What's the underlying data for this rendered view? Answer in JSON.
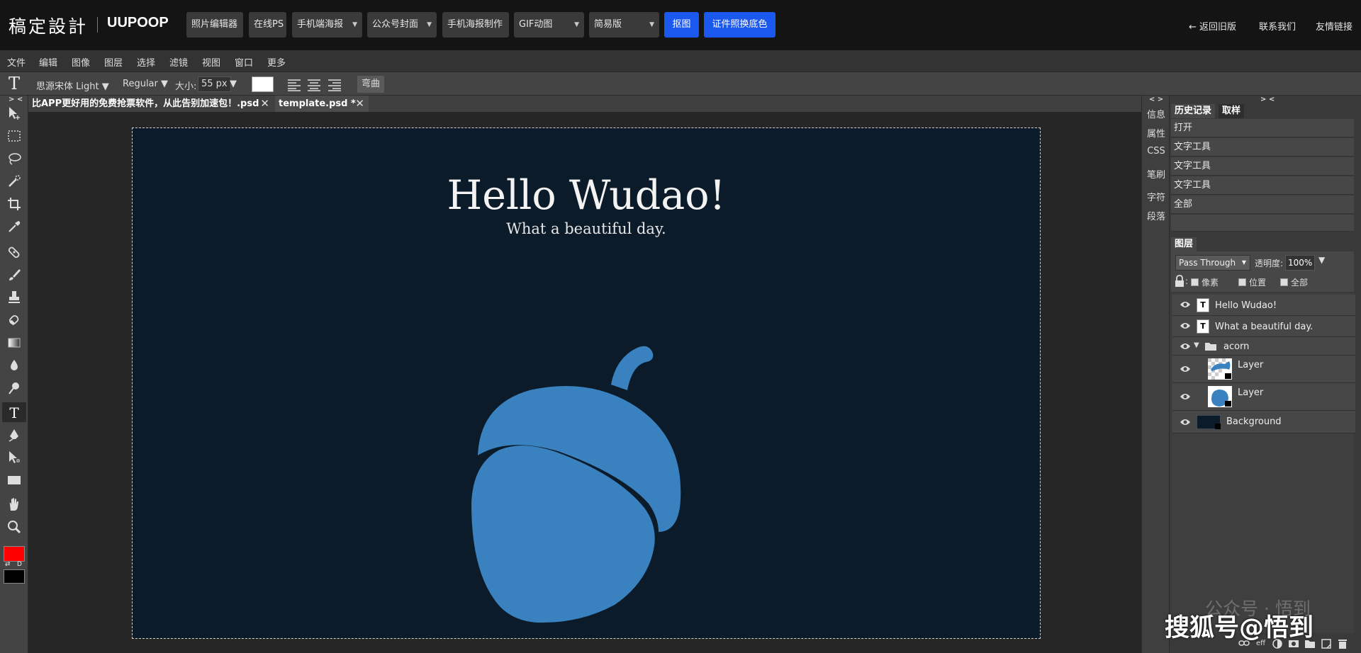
{
  "topbar": {
    "logo": "稿定設計",
    "brand": "UUPOOP",
    "buttons": [
      {
        "label": "照片编辑器"
      },
      {
        "label": "在线PS"
      },
      {
        "label": "手机端海报"
      },
      {
        "label": "公众号封面"
      },
      {
        "label": "手机海报制作"
      },
      {
        "label": "GIF动图"
      },
      {
        "label": "简易版"
      }
    ],
    "blue_buttons": [
      {
        "label": "抠图"
      },
      {
        "label": "证件照换底色"
      }
    ],
    "links": {
      "back_old": "← 返回旧版",
      "contact": "联系我们",
      "friend_links": "友情链接"
    }
  },
  "menubar": [
    "文件",
    "编辑",
    "图像",
    "图层",
    "选择",
    "滤镜",
    "视图",
    "窗口",
    "更多"
  ],
  "options": {
    "font_family": "思源宋体 Light ▼",
    "font_style": "Regular ▼",
    "size_label": "大小:",
    "size_value": "55 px",
    "size_arrow": "▼",
    "warp": "弯曲",
    "text_color": "#ffffff"
  },
  "colors": {
    "foreground": "#ff0000",
    "background": "#000000",
    "accent": "#1a58f0",
    "canvas": "#0b1b29",
    "acorn": "#3a81bf"
  },
  "toolbox": {
    "collapse": "> <",
    "swap": "⇄",
    "default": "D"
  },
  "tabs": [
    {
      "label": "比APP更好用的免费抢票软件，从此告别加速包！.psd",
      "close": "✕"
    },
    {
      "label": "template.psd *",
      "close": "✕"
    }
  ],
  "canvas": {
    "title": "Hello Wudao!",
    "subtitle": "What a beautiful day."
  },
  "mini_panel": {
    "toggle": "< >",
    "items": [
      "信息",
      "属性",
      "CSS",
      "笔刷",
      "字符",
      "段落"
    ]
  },
  "right_panel": {
    "toggle": "> <",
    "history_tabs": [
      "历史记录",
      "取样"
    ],
    "history": [
      "打开",
      "文字工具",
      "文字工具",
      "文字工具",
      "全部"
    ],
    "layers_tab": "图层",
    "blend_mode": "Pass Through",
    "opacity_label": "透明度:",
    "opacity_value": "100%",
    "lock_label": ":",
    "lock_options": [
      "像素",
      "位置",
      "全部"
    ],
    "layers": [
      {
        "name": "Hello Wudao!"
      },
      {
        "name": "What a beautiful day."
      },
      {
        "name": "acorn"
      },
      {
        "name": "Layer"
      },
      {
        "name": "Layer"
      },
      {
        "name": "Background"
      }
    ],
    "footer_eff": "eff"
  },
  "watermark": {
    "line1": "公众号 · 悟到",
    "line2": "搜狐号@悟到"
  }
}
